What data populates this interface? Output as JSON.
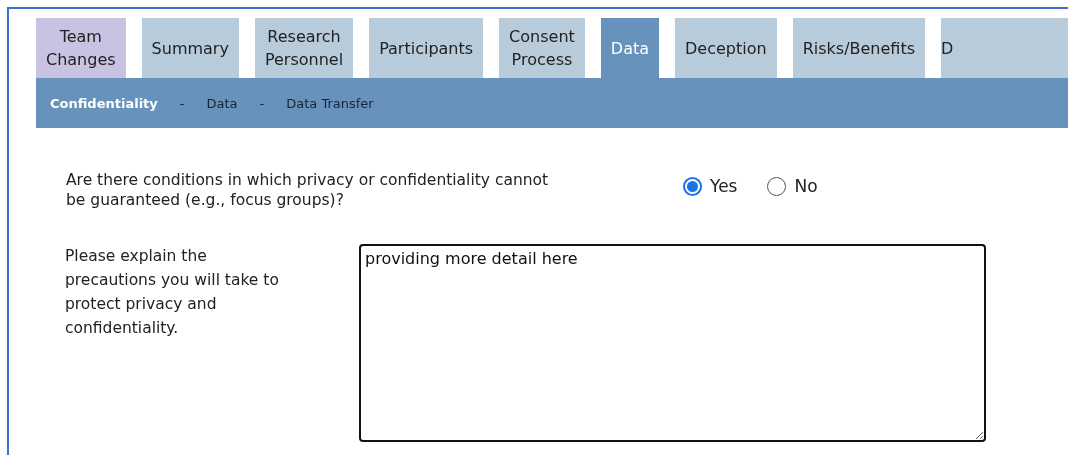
{
  "tabs": [
    {
      "label": "Team\nChanges",
      "kind": "team",
      "selected": false
    },
    {
      "label": "Summary",
      "kind": "step",
      "selected": false
    },
    {
      "label": "Research\nPersonnel",
      "kind": "step",
      "selected": false
    },
    {
      "label": "Participants",
      "kind": "step",
      "selected": false
    },
    {
      "label": "Consent\nProcess",
      "kind": "step",
      "selected": false
    },
    {
      "label": "Data",
      "kind": "step",
      "selected": true
    },
    {
      "label": "Deception",
      "kind": "step",
      "selected": false
    },
    {
      "label": "Risks/Benefits",
      "kind": "step",
      "selected": false
    },
    {
      "label": "D",
      "kind": "step",
      "selected": false
    }
  ],
  "subnav": {
    "items": [
      {
        "label": "Confidentiality",
        "selected": true
      },
      {
        "label": "Data",
        "selected": false
      },
      {
        "label": "Data Transfer",
        "selected": false
      }
    ],
    "separator": "-"
  },
  "question": {
    "text": "Are there conditions in which privacy or confidentiality cannot\nbe guaranteed (e.g., focus groups)?",
    "options": [
      {
        "label": "Yes",
        "selected": true
      },
      {
        "label": "No",
        "selected": false
      }
    ]
  },
  "explain": {
    "label": "Please explain the\nprecautions you will take to\nprotect privacy and\nconfidentiality.",
    "value": "providing more detail here"
  }
}
